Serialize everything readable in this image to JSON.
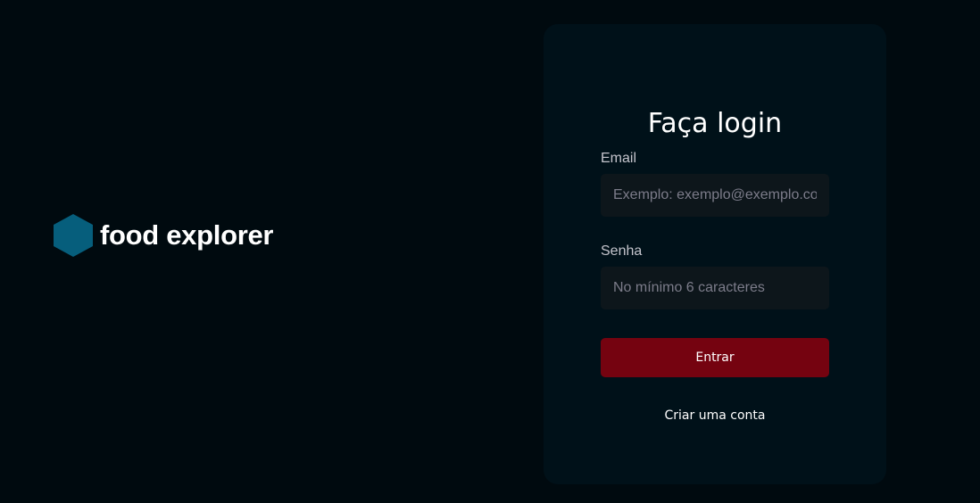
{
  "brand": {
    "name": "food explorer",
    "icon": "hexagon-icon",
    "icon_color": "#065e7c"
  },
  "login": {
    "title": "Faça login",
    "email": {
      "label": "Email",
      "value": "",
      "placeholder": "Exemplo: exemplo@exemplo.com.br"
    },
    "password": {
      "label": "Senha",
      "value": "",
      "placeholder": "No mínimo 6 caracteres"
    },
    "submit_label": "Entrar",
    "create_account_label": "Criar uma conta"
  },
  "colors": {
    "background": "#000a0f",
    "card": "#001119",
    "input": "#0d161b",
    "primary_button": "#750310"
  }
}
